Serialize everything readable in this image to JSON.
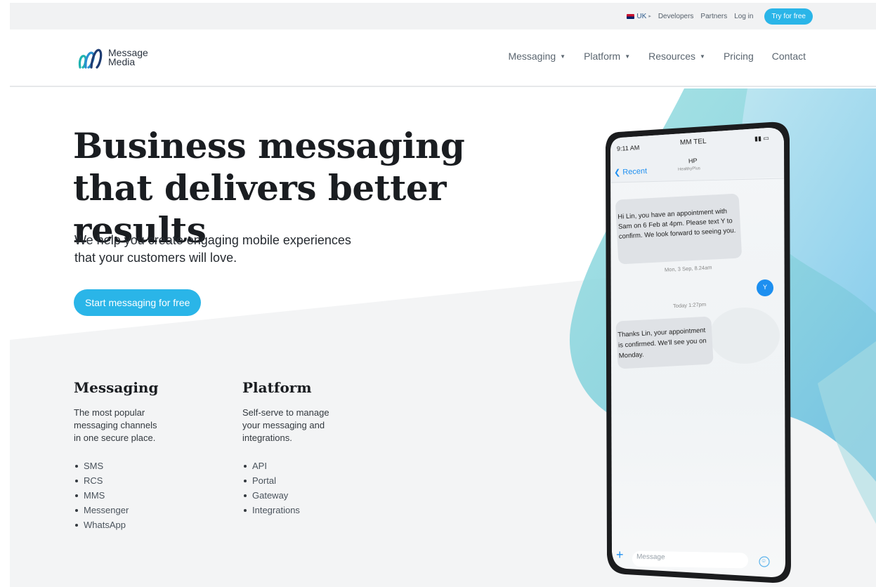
{
  "utility": {
    "region": "UK",
    "links": [
      "Developers",
      "Partners",
      "Log in"
    ],
    "try_button": "Try for free"
  },
  "nav": {
    "logo_line1": "Message",
    "logo_line2": "Media",
    "items": [
      {
        "label": "Messaging",
        "has_caret": true
      },
      {
        "label": "Platform",
        "has_caret": true
      },
      {
        "label": "Resources",
        "has_caret": true
      },
      {
        "label": "Pricing",
        "has_caret": false
      },
      {
        "label": "Contact",
        "has_caret": false
      }
    ]
  },
  "hero": {
    "title_line1": "Business messaging",
    "title_line2": "that delivers better results",
    "subtitle_line1": "We help you create engaging mobile experiences",
    "subtitle_line2": "that your customers will love.",
    "cta": "Start messaging for free"
  },
  "features": [
    {
      "heading": "Messaging",
      "desc_lines": [
        "The most popular",
        "messaging channels",
        "in one secure place."
      ],
      "items": [
        "SMS",
        "RCS",
        "MMS",
        "Messenger",
        "WhatsApp"
      ]
    },
    {
      "heading": "Platform",
      "desc_lines": [
        "Self-serve to manage",
        "your messaging and",
        "integrations."
      ],
      "items": [
        "API",
        "Portal",
        "Gateway",
        "Integrations"
      ]
    }
  ],
  "phone": {
    "time": "9:11 AM",
    "carrier": "MM TEL",
    "back_label": "Recent",
    "contact_initials": "HP",
    "contact_name": "HealthyPlus",
    "msg1_lines": [
      "Hi Lin, you have an appointment with",
      "Sam on 6 Feb at 4pm. Please text Y to",
      "confirm. We look forward to seeing you."
    ],
    "timestamp1": "Mon, 3 Sep, 8.24am",
    "reply": "Y",
    "timestamp2": "Today 1:27pm",
    "msg2_lines": [
      "Thanks Lin, your appointment",
      "is confirmed. We'll see you on",
      "Monday."
    ],
    "input_placeholder": "Message"
  },
  "colors": {
    "accent": "#2ab5e8",
    "heading": "#1a1d21",
    "band_gray": "#f3f4f5"
  },
  "icons": [
    "uk-flag-icon",
    "caret-down-icon",
    "logo-icon",
    "back-chevron-icon",
    "signal-icon",
    "battery-icon",
    "plus-icon",
    "emoji-icon"
  ]
}
